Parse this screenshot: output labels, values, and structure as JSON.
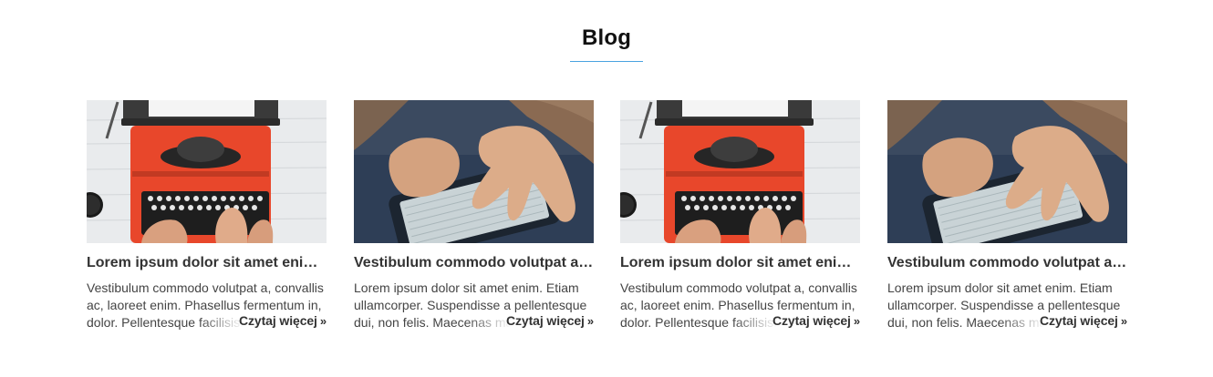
{
  "section": {
    "title": "Blog"
  },
  "colors": {
    "accent": "#4aa3e0",
    "typewriter": "#e8472b",
    "screen": "#c9d3d6"
  },
  "posts": [
    {
      "image": "typewriter-photo",
      "title": "Lorem ipsum dolor sit amet enim. Etiam ullamcorper.",
      "excerpt": "Vestibulum commodo volutpat a, convallis ac, laoreet enim. Phasellus fermentum in, dolor. Pellentesque facilisis.",
      "read_more": "Czytaj więcej"
    },
    {
      "image": "smartphone-photo",
      "title": "Vestibulum commodo volutpat a, convallis ac, laoreet enim.",
      "excerpt": "Lorem ipsum dolor sit amet enim. Etiam ullamcorper. Suspendisse a pellentesque dui, non felis. Maecenas malesuada.",
      "read_more": "Czytaj więcej"
    },
    {
      "image": "typewriter-photo",
      "title": "Lorem ipsum dolor sit amet enim. Etiam ullamcorper.",
      "excerpt": "Vestibulum commodo volutpat a, convallis ac, laoreet enim. Phasellus fermentum in, dolor. Pellentesque facilisis.",
      "read_more": "Czytaj więcej"
    },
    {
      "image": "smartphone-photo",
      "title": "Vestibulum commodo volutpat a, convallis ac, laoreet enim.",
      "excerpt": "Lorem ipsum dolor sit amet enim. Etiam ullamcorper. Suspendisse a pellentesque dui, non felis. Maecenas malesuada.",
      "read_more": "Czytaj więcej"
    }
  ]
}
